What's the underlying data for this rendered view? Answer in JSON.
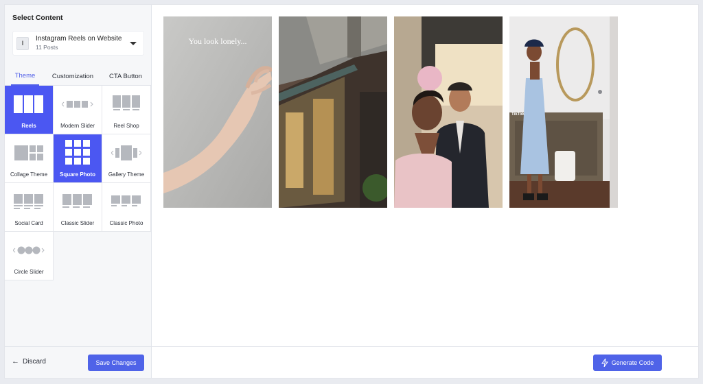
{
  "sidebar": {
    "title": "Select Content",
    "source": {
      "badge": "I",
      "name": "Instagram Reels on Website",
      "count": "11 Posts"
    },
    "tabs": [
      {
        "label": "Theme",
        "active": true
      },
      {
        "label": "Customization",
        "active": false
      },
      {
        "label": "CTA Button",
        "active": false
      }
    ],
    "themes": [
      {
        "label": "Reels",
        "icon": "reels-icon",
        "active": true
      },
      {
        "label": "Modern Slider",
        "icon": "modern-slider-icon",
        "active": false
      },
      {
        "label": "Reel Shop",
        "icon": "reel-shop-icon",
        "active": false
      },
      {
        "label": "Collage Theme",
        "icon": "collage-icon",
        "active": false
      },
      {
        "label": "Square Photo",
        "icon": "square-photo-icon",
        "active": true
      },
      {
        "label": "Gallery Theme",
        "icon": "gallery-icon",
        "active": false
      },
      {
        "label": "Social Card",
        "icon": "social-card-icon",
        "active": false
      },
      {
        "label": "Classic Slider",
        "icon": "classic-slider-icon",
        "active": false
      },
      {
        "label": "Classic Photo",
        "icon": "classic-photo-icon",
        "active": false
      },
      {
        "label": "Circle Slider",
        "icon": "circle-slider-icon",
        "active": false
      }
    ],
    "footer": {
      "discard_label": "Discard",
      "save_label": "Save Changes"
    }
  },
  "preview": {
    "tiles": [
      {
        "caption": "You look lonely...",
        "scene": "hand reaching"
      },
      {
        "caption": "",
        "scene": "building street"
      },
      {
        "caption": "",
        "scene": "couple selfie"
      },
      {
        "caption": "",
        "scene": "woman in blue dress",
        "overlay": "TikTok"
      }
    ]
  },
  "main": {
    "generate_label": "Generate Code"
  },
  "colors": {
    "accent": "#4f5ee8",
    "active_tile": "#4b57f2",
    "button": "#4f63e8"
  }
}
